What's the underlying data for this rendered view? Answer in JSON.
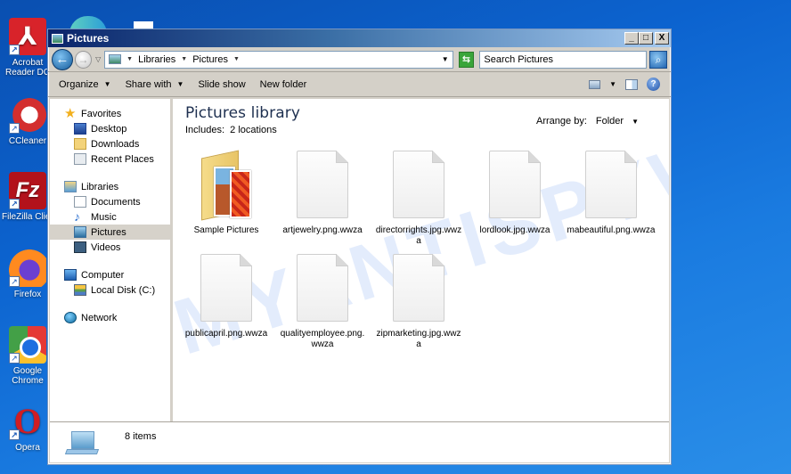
{
  "desktop": {
    "icons": [
      {
        "label": "Acrobat Reader DC",
        "icon": "acrobat-icon",
        "glyph": "⅄"
      },
      {
        "label": "CCleaner",
        "icon": "ccleaner-icon"
      },
      {
        "label": "FileZilla Client",
        "icon": "filezilla-icon",
        "glyph": "Fz"
      },
      {
        "label": "Firefox",
        "icon": "firefox-icon"
      },
      {
        "label": "Google Chrome",
        "icon": "chrome-icon"
      },
      {
        "label": "Opera",
        "icon": "opera-icon",
        "glyph": "O"
      }
    ]
  },
  "window": {
    "title": "Pictures",
    "controls": {
      "minimize": "_",
      "maximize": "□",
      "close": "X"
    }
  },
  "navbar": {
    "back_glyph": "←",
    "forward_glyph": "→",
    "breadcrumb": [
      "Libraries",
      "Pictures"
    ],
    "refresh_glyph": "⇆",
    "search_placeholder": "Search Pictures",
    "search_glyph": "⌕"
  },
  "toolbar": {
    "organize": "Organize",
    "share_with": "Share with",
    "slide_show": "Slide show",
    "new_folder": "New folder"
  },
  "sidebar": {
    "favorites": {
      "label": "Favorites",
      "items": [
        "Desktop",
        "Downloads",
        "Recent Places"
      ]
    },
    "libraries": {
      "label": "Libraries",
      "items": [
        "Documents",
        "Music",
        "Pictures",
        "Videos"
      ],
      "selected": "Pictures"
    },
    "computer": {
      "label": "Computer",
      "items": [
        "Local Disk (C:)"
      ]
    },
    "network": {
      "label": "Network"
    }
  },
  "content": {
    "title": "Pictures library",
    "includes_label": "Includes:",
    "includes_value": "2 locations",
    "arrange_label": "Arrange by:",
    "arrange_value": "Folder",
    "files": [
      {
        "name": "Sample Pictures",
        "type": "folder"
      },
      {
        "name": "artjewelry.png.wwza",
        "type": "file"
      },
      {
        "name": "directorrights.jpg.wwza",
        "type": "file"
      },
      {
        "name": "lordlook.jpg.wwza",
        "type": "file"
      },
      {
        "name": "mabeautiful.png.wwza",
        "type": "file"
      },
      {
        "name": "publicapril.png.wwza",
        "type": "file"
      },
      {
        "name": "qualityemployee.png.wwza",
        "type": "file"
      },
      {
        "name": "zipmarketing.jpg.wwza",
        "type": "file"
      }
    ]
  },
  "status": {
    "item_count": "8 items"
  },
  "watermark": "MYANTISPYWARE.COM"
}
